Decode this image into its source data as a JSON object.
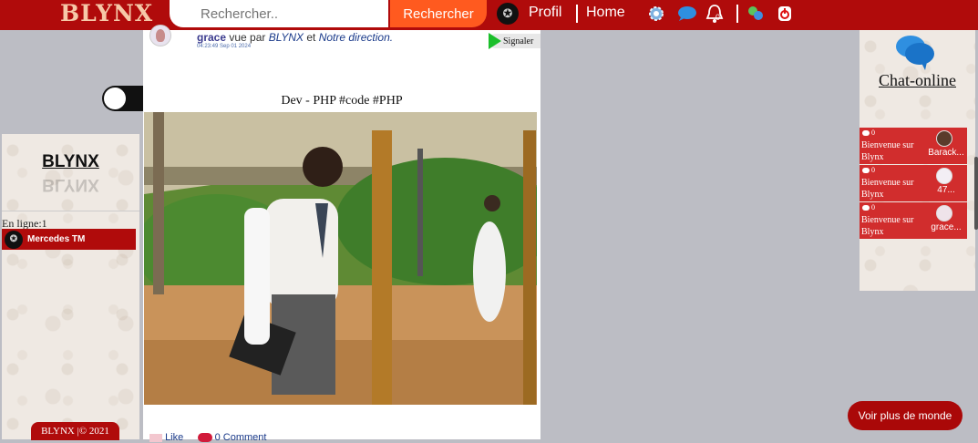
{
  "navbar": {
    "logo": "BLYNX",
    "search_placeholder": "Rechercher..",
    "search_button": "Rechercher",
    "profile_label": "Profil",
    "home_label": "Home",
    "notification_count": "0"
  },
  "left_panel": {
    "brand": "BLYNX",
    "online_label": "En ligne:1",
    "online_users": [
      {
        "name": "Mercedes TM"
      }
    ],
    "copyright": "BLYNX |© 2021"
  },
  "post": {
    "author": "grace",
    "seen_text": "vue par",
    "seen_by_1": "BLYNX",
    "and_text": "et",
    "seen_by_2": "Notre direction.",
    "timestamp": "04:23:49 Sep 01 2024",
    "report_label": "Signaler",
    "caption": "Dev - PHP #code #PHP",
    "like_label": "Like",
    "comment_label": "0 Comment"
  },
  "chat": {
    "title": "Chat-online",
    "items": [
      {
        "count": "0",
        "message": "Bienvenue sur Blynx",
        "name": "Barack..."
      },
      {
        "count": "0",
        "message": "Bienvenue sur Blynx",
        "name": "47..."
      },
      {
        "count": "0",
        "message": "Bienvenue sur Blynx",
        "name": "grace..."
      }
    ]
  },
  "more_button": "Voir plus de monde",
  "colors": {
    "navbar": "#b00b0b",
    "search_button": "#ff5a1f",
    "chat_item": "#d12d2d",
    "more_button": "#aa0808",
    "page_bg": "#bcbdc4"
  }
}
